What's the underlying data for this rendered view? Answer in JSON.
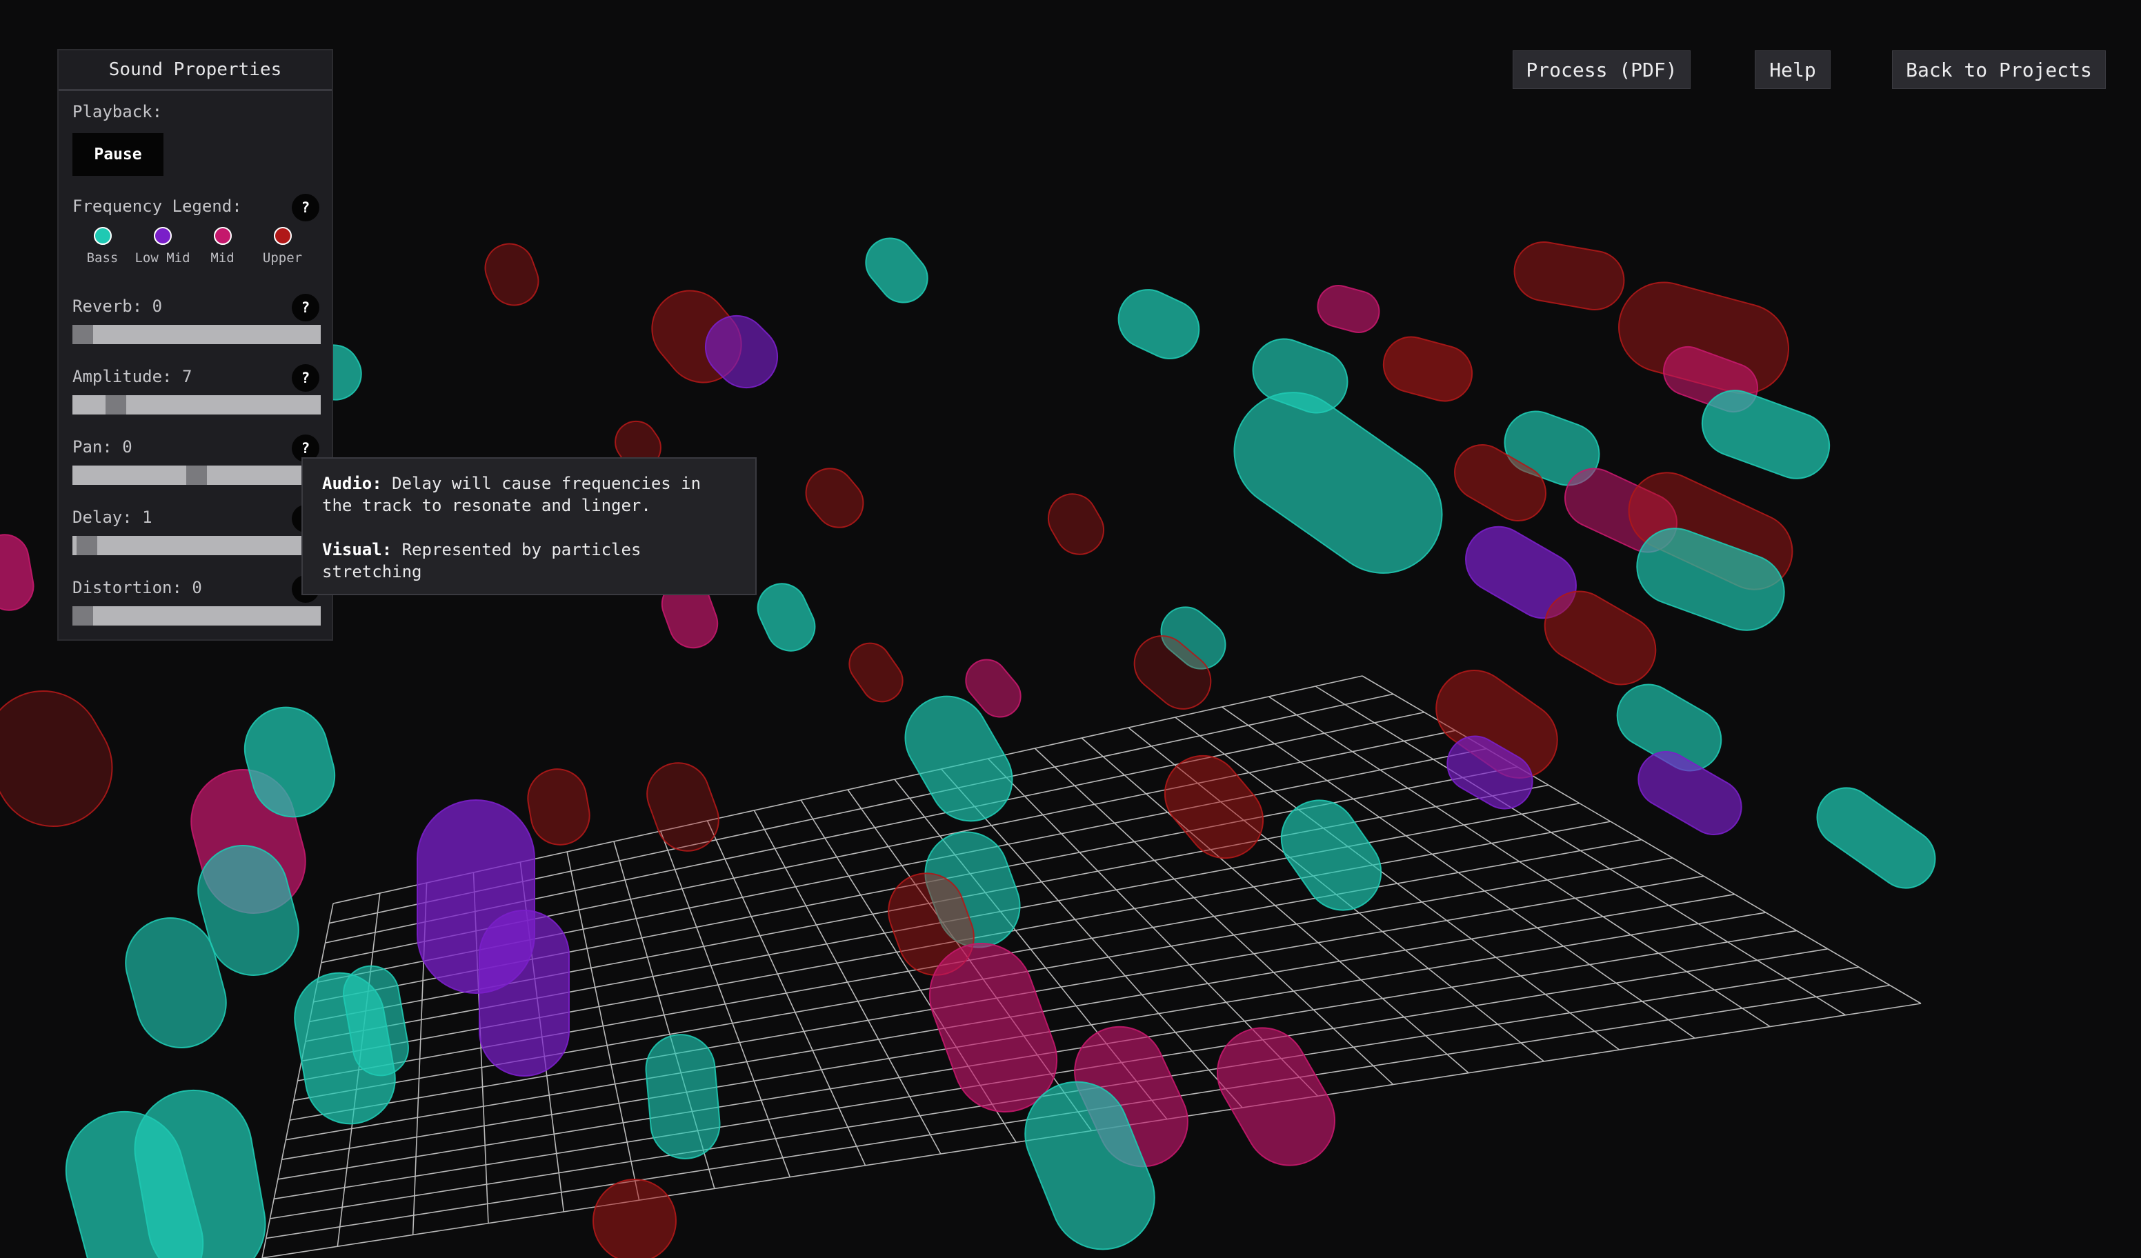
{
  "panel": {
    "title": "Sound Properties",
    "playback_label": "Playback:",
    "pause_label": "Pause",
    "legend_label": "Frequency Legend:",
    "legend": [
      {
        "label": "Bass",
        "color": "#1fc9b3"
      },
      {
        "label": "Low Mid",
        "color": "#7a1fc9"
      },
      {
        "label": "Mid",
        "color": "#c4186c"
      },
      {
        "label": "Upper",
        "color": "#b01818"
      }
    ],
    "help_glyph": "?",
    "reverb_label": "Reverb: 0",
    "reverb_value": 0,
    "amplitude_label": "Amplitude: 7",
    "amplitude_value": 7,
    "pan_label": "Pan: 0",
    "pan_value": 0,
    "delay_label": "Delay: 1",
    "delay_value": 1,
    "distortion_label": "Distortion: 0",
    "distortion_value": 0
  },
  "tooltip": {
    "audio_title": "Audio:",
    "audio_text": " Delay will cause frequencies in the track to resonate and linger.",
    "visual_title": "Visual:",
    "visual_text": " Represented by particles stretching"
  },
  "toolbar": {
    "process_label": "Process (PDF)",
    "help_label": "Help",
    "back_label": "Back to Projects"
  },
  "colors": {
    "bass": "#1fc9b3",
    "low_mid": "#7a1fc9",
    "mid": "#c4186c",
    "upper": "#b01818",
    "background": "#0b0b0c"
  }
}
